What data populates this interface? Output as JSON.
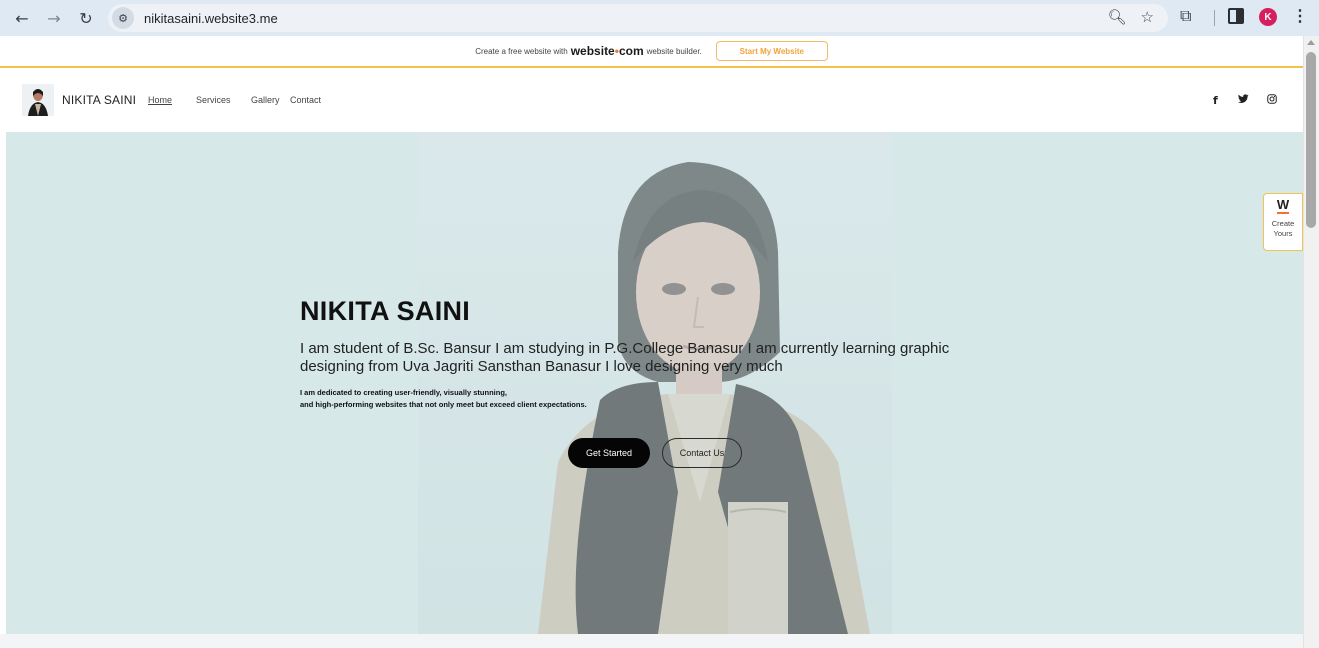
{
  "browser": {
    "url": "nikitasaini.website3.me",
    "profile_initial": "K",
    "icons": [
      "back-icon",
      "forward-icon",
      "reload-icon",
      "site-info-icon",
      "zoom-icon",
      "star-icon",
      "extensions-icon",
      "side-panel-icon",
      "menu-icon"
    ]
  },
  "promo": {
    "text": "Create a free website with",
    "brand_left": "website",
    "brand_dot": "•",
    "brand_right": "com",
    "after": "website builder.",
    "button": "Start My Website"
  },
  "header": {
    "site_name": "NIKITA SAINI",
    "nav": [
      "Home",
      "Services",
      "Gallery",
      "Contact"
    ],
    "social_icons": [
      "facebook-icon",
      "twitter-icon",
      "instagram-icon"
    ]
  },
  "hero": {
    "title": "NIKITA SAINI",
    "description": "I am student of  B.Sc.  Bansur I am studying in P.G.College Banasur I am currently learning graphic\ndesigning from Uva Jagriti Sansthan Banasur I love designing very much",
    "subtext": "I am dedicated to creating user-friendly, visually stunning,\nand high-performing websites that not only meet but exceed client expectations.",
    "primary_button": "Get Started",
    "secondary_button": "Contact Us"
  },
  "widget": {
    "logo": "W",
    "label": "Create\nYours"
  },
  "colors": {
    "hero_bg": "#d6e8e7",
    "promo_accent": "#f0a33c",
    "primary_button": "#050505"
  }
}
